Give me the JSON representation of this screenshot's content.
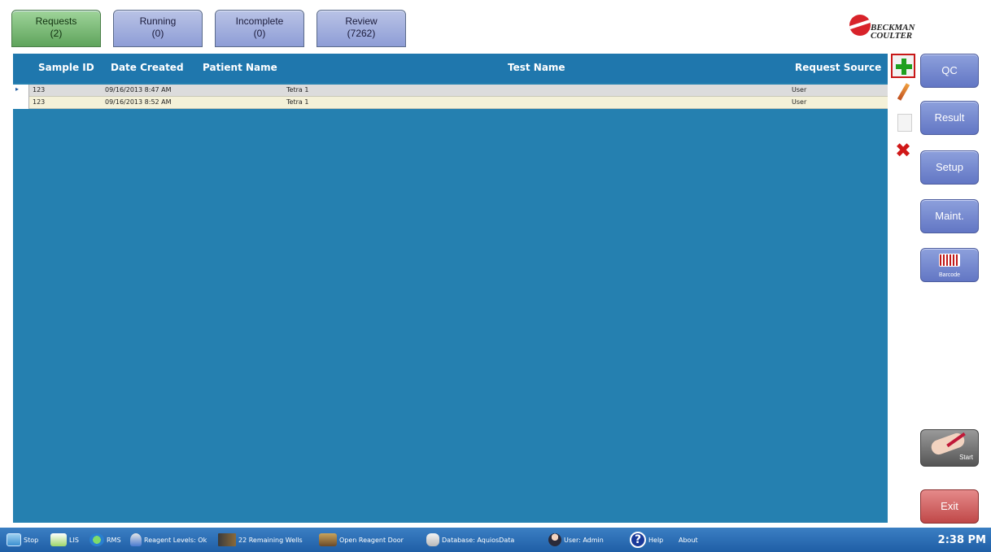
{
  "tabs": [
    {
      "label": "Requests",
      "count": "(2)",
      "active": true
    },
    {
      "label": "Running",
      "count": "(0)",
      "active": false
    },
    {
      "label": "Incomplete",
      "count": "(0)",
      "active": false
    },
    {
      "label": "Review",
      "count": "(7262)",
      "active": false
    }
  ],
  "logo": {
    "line1": "BECKMAN",
    "line2": "COULTER"
  },
  "grid": {
    "columns": [
      "Sample ID",
      "Date Created",
      "Patient Name",
      "Test Name",
      "Request Source"
    ],
    "rows": [
      {
        "sample_id": "123",
        "date_created": "09/16/2013 8:47 AM",
        "patient_name": "",
        "test_name": "Tetra 1",
        "request_source": "User"
      },
      {
        "sample_id": "123",
        "date_created": "09/16/2013 8:52 AM",
        "patient_name": "",
        "test_name": "Tetra 1",
        "request_source": "User"
      }
    ]
  },
  "actions": [
    "plus-icon",
    "pencil-icon",
    "copy-icon",
    "delete-icon"
  ],
  "side_buttons": {
    "qc": "QC",
    "result": "Result",
    "setup": "Setup",
    "maint": "Maint.",
    "barcode": "Barcode",
    "start": "Start",
    "exit": "Exit"
  },
  "statusbar": {
    "stop": "Stop",
    "lis": "LIS",
    "rms": "RMS",
    "reagent_levels": "Reagent Levels: Ok",
    "remaining_wells": "22 Remaining Wells",
    "open_reagent_door": "Open Reagent Door",
    "database": "Database: AquiosData",
    "user": "User: Admin",
    "help": "Help",
    "about": "About",
    "time": "2:38 PM"
  },
  "colors": {
    "grid_bg": "#2580b0",
    "tab_active": "#6fb46a",
    "tab_inactive": "#9aa8dc",
    "exit": "#c85050",
    "add_highlight": "#c81818"
  }
}
